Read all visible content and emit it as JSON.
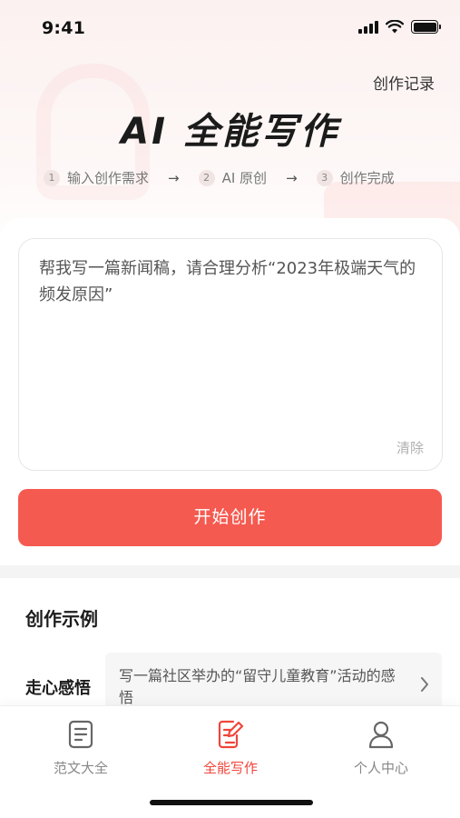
{
  "status": {
    "time": "9:41"
  },
  "header": {
    "history_label": "创作记录",
    "title": "AI 全能写作"
  },
  "steps": [
    {
      "num": "1",
      "label": "输入创作需求"
    },
    {
      "num": "2",
      "label": "AI 原创"
    },
    {
      "num": "3",
      "label": "创作完成"
    }
  ],
  "step_arrow": "→",
  "prompt": {
    "text": "帮我写一篇新闻稿，请合理分析“2023年极端天气的频发原因”",
    "clear_label": "清除"
  },
  "start_button": "开始创作",
  "examples": {
    "title": "创作示例",
    "items": [
      {
        "category": "走心感悟",
        "text": "写一篇社区举办的“留守儿童教育”活动的感悟"
      }
    ]
  },
  "tabbar": {
    "items": [
      {
        "label": "范文大全",
        "icon": "document-icon",
        "active": false
      },
      {
        "label": "全能写作",
        "icon": "edit-document-icon",
        "active": true
      },
      {
        "label": "个人中心",
        "icon": "user-icon",
        "active": false
      }
    ]
  },
  "colors": {
    "accent": "#f55a50",
    "active_tab": "#f0453a"
  }
}
